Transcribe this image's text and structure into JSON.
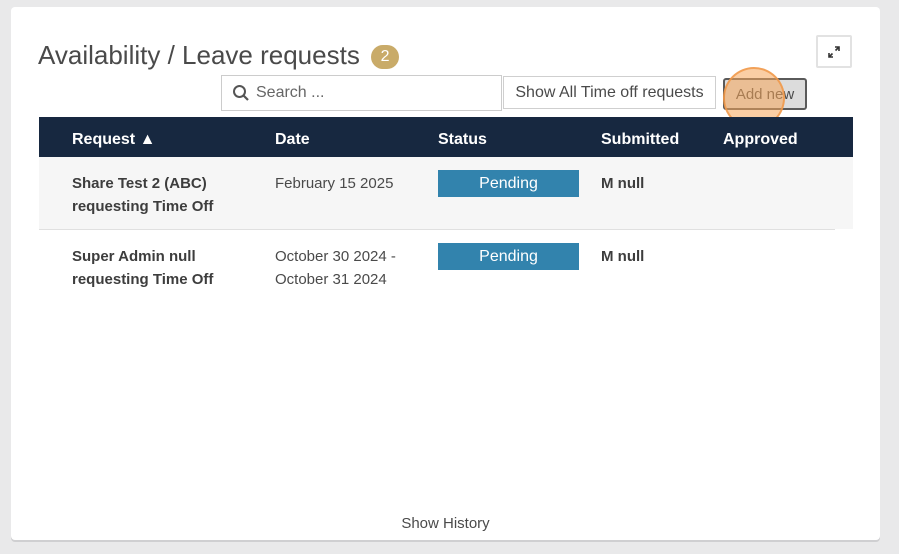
{
  "header": {
    "title": "Availability / Leave requests",
    "count": "2"
  },
  "toolbar": {
    "search_placeholder": "Search ...",
    "show_all_label": "Show All Time off requests",
    "add_new_label": "Add new"
  },
  "table": {
    "columns": [
      "Request ▲",
      "Date",
      "Status",
      "Submitted",
      "Approved"
    ],
    "rows": [
      {
        "request_line1": "Share Test 2 (ABC)",
        "request_line2": "requesting Time Off",
        "date_line1": "February 15 2025",
        "date_line2": "",
        "status": "Pending",
        "submitted": "M null",
        "approved": ""
      },
      {
        "request_line1": "Super Admin null",
        "request_line2": "requesting Time Off",
        "date_line1": "October 30 2024 -",
        "date_line2": "October 31 2024",
        "status": "Pending",
        "submitted": "M null",
        "approved": ""
      }
    ]
  },
  "footer": {
    "show_history_label": "Show History"
  },
  "colors": {
    "header_bg": "#172840",
    "status_pending": "#3283ad",
    "badge": "#c9ab69"
  },
  "icons": {
    "expand": "expand-icon",
    "search": "search-icon"
  }
}
